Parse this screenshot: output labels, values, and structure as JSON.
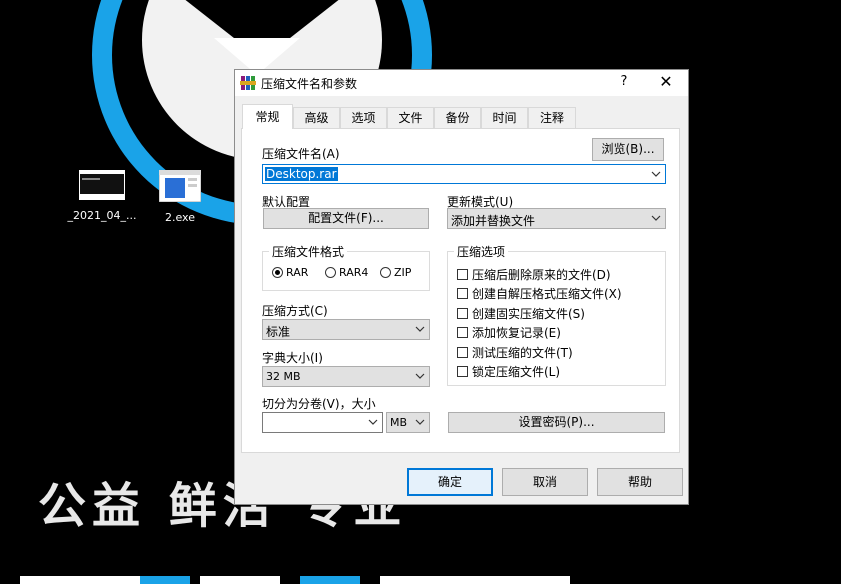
{
  "desktop": {
    "icons": [
      {
        "label": "_2021_04_...",
        "icon": "image-file-icon"
      },
      {
        "label": "2.exe",
        "icon": "exe-file-icon"
      }
    ],
    "wallpaper_text": "公益  鲜活  专业",
    "accent_color": "#1aa3e8"
  },
  "dialog": {
    "title": "压缩文件名和参数",
    "help_glyph": "?",
    "close_glyph": "✕",
    "tabs": [
      "常规",
      "高级",
      "选项",
      "文件",
      "备份",
      "时间",
      "注释"
    ],
    "active_tab": "常规",
    "archive_name_label": "压缩文件名(A)",
    "browse_button": "浏览(B)...",
    "archive_name_value": "Desktop.rar",
    "default_profile_label": "默认配置",
    "profiles_button": "配置文件(F)...",
    "update_mode_label": "更新模式(U)",
    "update_mode_value": "添加并替换文件",
    "format_group_title": "压缩文件格式",
    "formats": [
      {
        "label": "RAR",
        "selected": true
      },
      {
        "label": "RAR4",
        "selected": false
      },
      {
        "label": "ZIP",
        "selected": false
      }
    ],
    "method_label": "压缩方式(C)",
    "method_value": "标准",
    "dict_label": "字典大小(I)",
    "dict_value": "32 MB",
    "split_label": "切分为分卷(V)，大小",
    "split_value": "",
    "split_unit": "MB",
    "options_group_title": "压缩选项",
    "options": [
      {
        "label": "压缩后删除原来的文件(D)",
        "checked": false
      },
      {
        "label": "创建自解压格式压缩文件(X)",
        "checked": false
      },
      {
        "label": "创建固实压缩文件(S)",
        "checked": false
      },
      {
        "label": "添加恢复记录(E)",
        "checked": false
      },
      {
        "label": "测试压缩的文件(T)",
        "checked": false
      },
      {
        "label": "锁定压缩文件(L)",
        "checked": false
      }
    ],
    "password_button": "设置密码(P)...",
    "ok_button": "确定",
    "cancel_button": "取消",
    "help_button": "帮助"
  }
}
